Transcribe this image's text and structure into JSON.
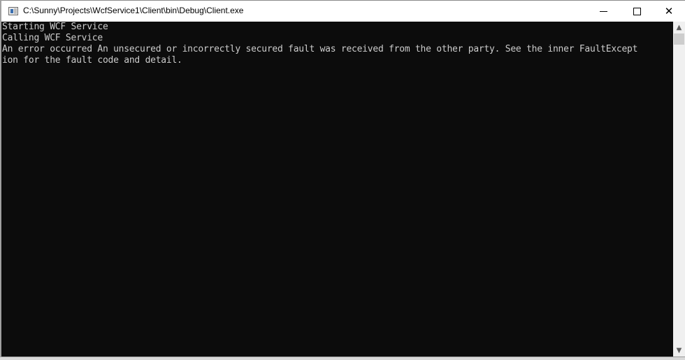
{
  "window": {
    "title": "C:\\Sunny\\Projects\\WcfService1\\Client\\bin\\Debug\\Client.exe",
    "icon": "console-app-icon",
    "controls": {
      "minimize": "—",
      "maximize": "",
      "close": "✕"
    }
  },
  "console": {
    "lines": [
      "Starting WCF Service",
      "Calling WCF Service",
      "An error occurred An unsecured or incorrectly secured fault was received from the other party. See the inner FaultExcept",
      "ion for the fault code and detail."
    ]
  },
  "scrollbar": {
    "up": "▲",
    "down": "▼"
  },
  "colors": {
    "console_bg": "#0c0c0c",
    "console_fg": "#cccccc",
    "titlebar_bg": "#ffffff"
  }
}
